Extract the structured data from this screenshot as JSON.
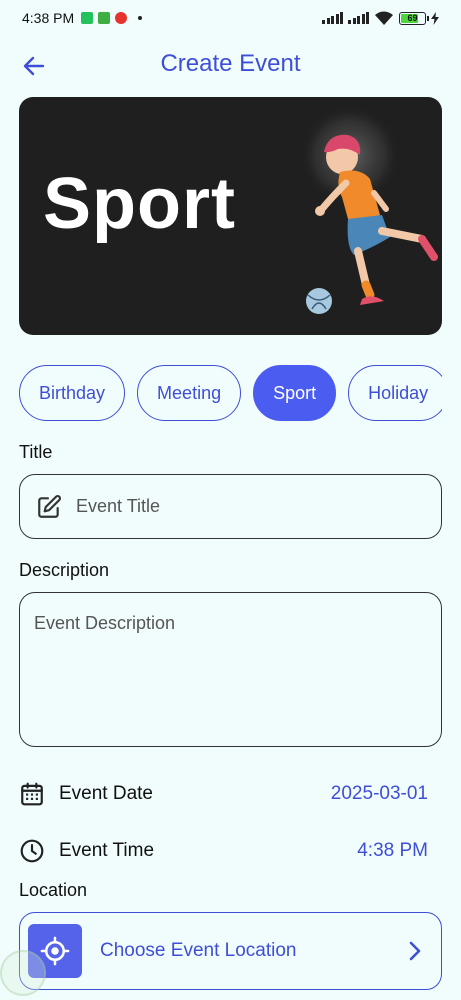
{
  "status_bar": {
    "time": "4:38 PM",
    "battery_level": "69",
    "icons": [
      "whatsapp-icon",
      "notification-icon",
      "record-icon",
      "signal-icon",
      "wifi-icon",
      "battery-icon",
      "charging-icon"
    ]
  },
  "header": {
    "title": "Create Event",
    "back_icon": "arrow-left-icon"
  },
  "banner": {
    "word": "Sport"
  },
  "categories": [
    {
      "label": "Birthday",
      "selected": false
    },
    {
      "label": "Meeting",
      "selected": false
    },
    {
      "label": "Sport",
      "selected": true
    },
    {
      "label": "Holiday",
      "selected": false
    }
  ],
  "form": {
    "title_label": "Title",
    "title_placeholder": "Event Title",
    "description_label": "Description",
    "description_placeholder": "Event Description",
    "date_label": "Event Date",
    "date_value": "2025-03-01",
    "time_label": "Event Time",
    "time_value": "4:38 PM",
    "location_label": "Location",
    "location_button": "Choose Event Location"
  },
  "colors": {
    "accent": "#3f4ed6",
    "chip_selected": "#4b5cf0",
    "background": "#f1fdfd",
    "banner_bg": "#1f1f1f"
  }
}
